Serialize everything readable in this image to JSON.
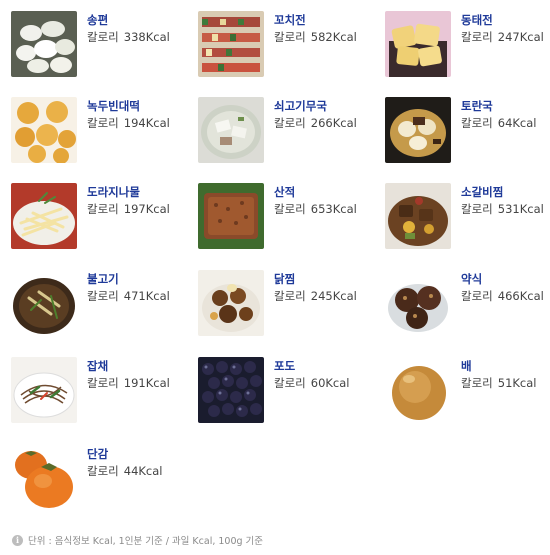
{
  "unit_label": "칼로리",
  "foods": [
    {
      "name": "송편",
      "kcal": "338Kcal",
      "image": "songpyeon-photo"
    },
    {
      "name": "꼬치전",
      "kcal": "582Kcal",
      "image": "kkochijeon-photo"
    },
    {
      "name": "동태전",
      "kcal": "247Kcal",
      "image": "dongtaejeon-photo"
    },
    {
      "name": "녹두빈대떡",
      "kcal": "194Kcal",
      "image": "bindaetteok-photo"
    },
    {
      "name": "쇠고기무국",
      "kcal": "266Kcal",
      "image": "beef-radish-soup-photo"
    },
    {
      "name": "토란국",
      "kcal": "64Kcal",
      "image": "taro-soup-photo"
    },
    {
      "name": "도라지나물",
      "kcal": "197Kcal",
      "image": "doraji-namul-photo"
    },
    {
      "name": "산적",
      "kcal": "653Kcal",
      "image": "sanjeok-photo"
    },
    {
      "name": "소갈비찜",
      "kcal": "531Kcal",
      "image": "galbijjim-photo"
    },
    {
      "name": "불고기",
      "kcal": "471Kcal",
      "image": "bulgogi-photo"
    },
    {
      "name": "닭찜",
      "kcal": "245Kcal",
      "image": "dakjjim-photo"
    },
    {
      "name": "약식",
      "kcal": "466Kcal",
      "image": "yaksik-photo"
    },
    {
      "name": "잡채",
      "kcal": "191Kcal",
      "image": "japchae-photo"
    },
    {
      "name": "포도",
      "kcal": "60Kcal",
      "image": "grapes-photo"
    },
    {
      "name": "배",
      "kcal": "51Kcal",
      "image": "pear-photo"
    },
    {
      "name": "단감",
      "kcal": "44Kcal",
      "image": "persimmon-photo"
    }
  ],
  "footnote": {
    "icon": "info-icon",
    "text": "단위 : 음식정보 Kcal, 1인분 기준 / 과일 Kcal, 100g 기준"
  }
}
